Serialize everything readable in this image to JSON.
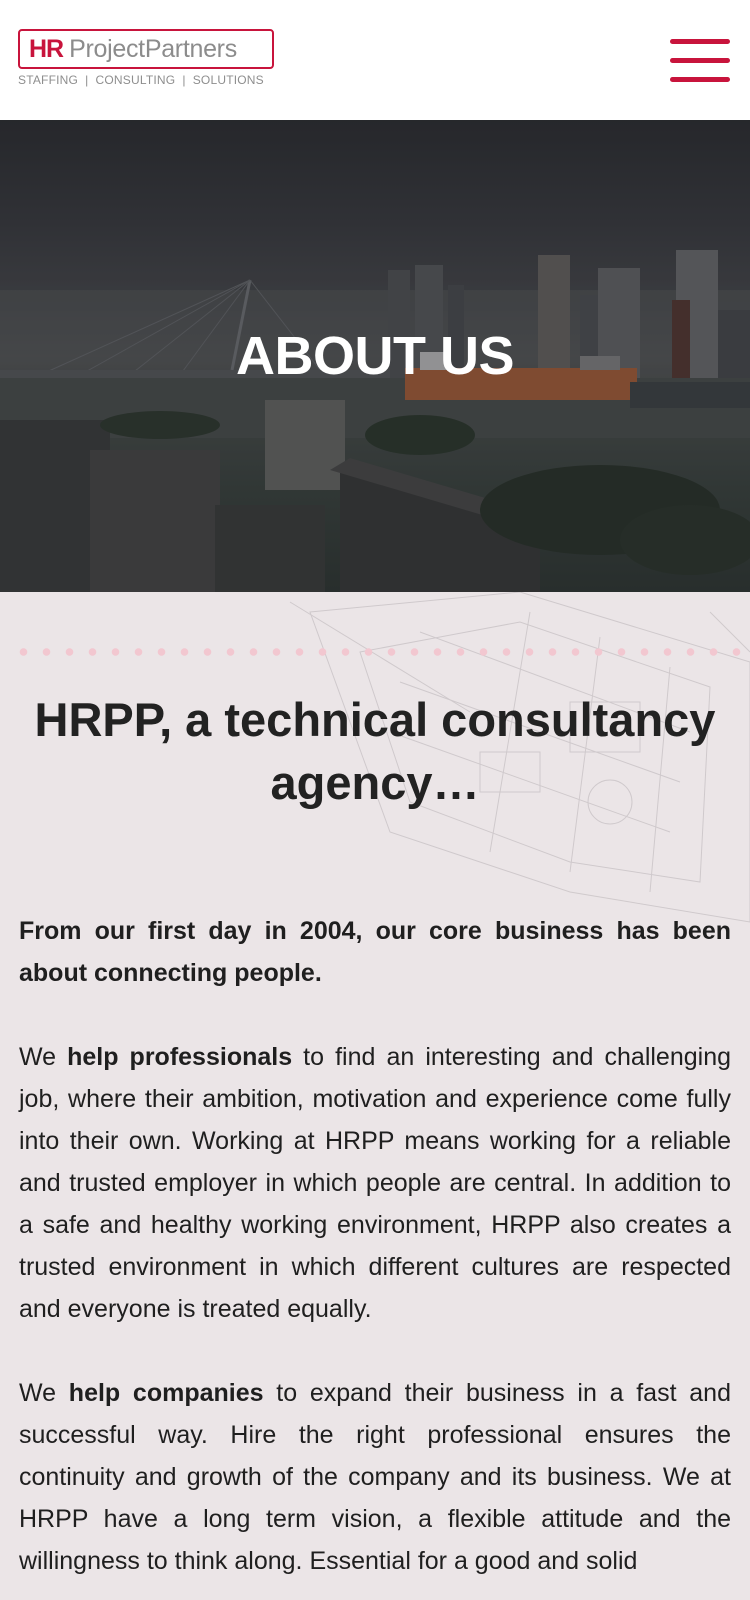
{
  "header": {
    "logo_hr": "HR",
    "logo_name": "ProjectPartners",
    "logo_tagline": "STAFFING  |  CONSULTING  |  SOLUTIONS",
    "brand_color": "#c8143c",
    "menu_icon": "hamburger-menu-icon"
  },
  "hero": {
    "title": "ABOUT US"
  },
  "main": {
    "heading": "HRPP, a technical consultancy agency…",
    "intro": "From our first day in 2004, our core business has been about connecting people.",
    "para2": {
      "before": "We ",
      "bold": "help professionals",
      "after": " to find an interesting and challenging job, where their ambition, motivation and experience come fully into their own. Working at HRPP means working for a reliable and trusted employer in which people are central. In addition to a safe and healthy working environment, HRPP also creates a trusted environment in which different cultures are respected and everyone is treated equally."
    },
    "para3": {
      "before": "We ",
      "bold": "help companies",
      "after": " to expand their business in a fast and successful way. Hire the right professional ensures the continuity and growth of the company and its business. We at HRPP have a long term vision, a flexible attitude and the willingness to think along. Essential for a good and solid"
    }
  }
}
